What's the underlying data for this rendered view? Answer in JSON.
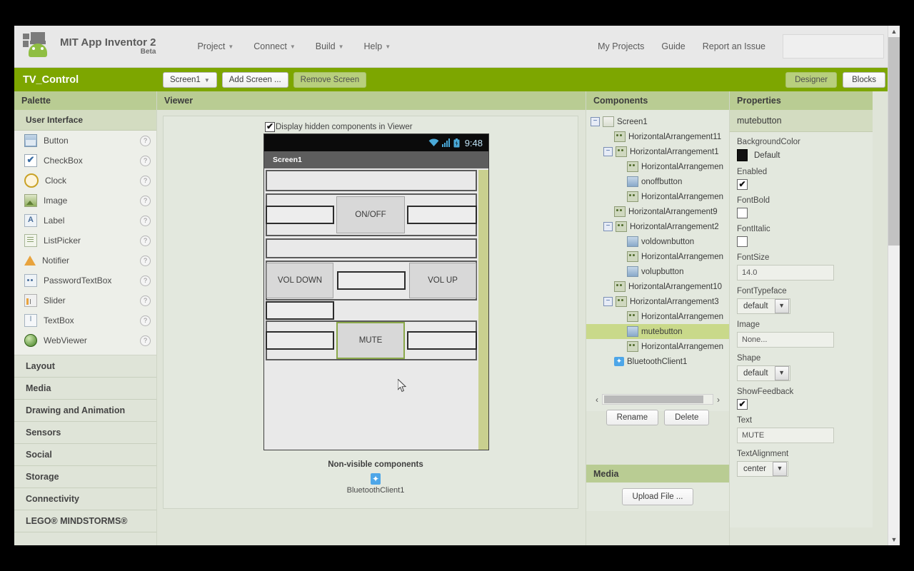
{
  "header": {
    "brand_name": "MIT App Inventor 2",
    "brand_sub": "Beta",
    "menus": [
      "Project",
      "Connect",
      "Build",
      "Help"
    ],
    "right_links": [
      "My Projects",
      "Guide",
      "Report an Issue"
    ],
    "search_value": ""
  },
  "project_bar": {
    "project_name": "TV_Control",
    "screen_select": "Screen1",
    "add_screen": "Add Screen ...",
    "remove_screen": "Remove Screen",
    "tabs": [
      "Designer",
      "Blocks"
    ],
    "active_tab": "Designer"
  },
  "palette": {
    "title": "Palette",
    "section": "User Interface",
    "items": [
      {
        "label": "Button",
        "icon": "button-icon"
      },
      {
        "label": "CheckBox",
        "icon": "checkbox-icon"
      },
      {
        "label": "Clock",
        "icon": "clock-icon"
      },
      {
        "label": "Image",
        "icon": "image-icon"
      },
      {
        "label": "Label",
        "icon": "label-icon"
      },
      {
        "label": "ListPicker",
        "icon": "listpicker-icon"
      },
      {
        "label": "Notifier",
        "icon": "notifier-icon"
      },
      {
        "label": "PasswordTextBox",
        "icon": "password-icon"
      },
      {
        "label": "Slider",
        "icon": "slider-icon"
      },
      {
        "label": "TextBox",
        "icon": "textbox-icon"
      },
      {
        "label": "WebViewer",
        "icon": "webviewer-icon"
      }
    ],
    "help_glyph": "?",
    "categories": [
      "Layout",
      "Media",
      "Drawing and Animation",
      "Sensors",
      "Social",
      "Storage",
      "Connectivity",
      "LEGO® MINDSTORMS®"
    ]
  },
  "viewer": {
    "title": "Viewer",
    "display_hidden_label": "Display hidden components in Viewer",
    "display_hidden_checked": true,
    "phone": {
      "status_time": "9:48",
      "screen_title": "Screen1",
      "buttons": {
        "onoff": "ON/OFF",
        "vol_down": "VOL DOWN",
        "vol_up": "VOL UP",
        "mute": "MUTE"
      },
      "selected_button": "MUTE"
    },
    "nonvisible_title": "Non-visible components",
    "nonvisible_items": [
      "BluetoothClient1"
    ]
  },
  "components": {
    "title": "Components",
    "tree": [
      {
        "label": "Screen1",
        "depth": 0,
        "icon": "screen-icon",
        "expander": "−",
        "selected": false
      },
      {
        "label": "HorizontalArrangement11",
        "depth": 1,
        "icon": "arrangement-icon",
        "expander": "",
        "selected": false
      },
      {
        "label": "HorizontalArrangement1",
        "depth": 1,
        "icon": "arrangement-icon",
        "expander": "−",
        "selected": false
      },
      {
        "label": "HorizontalArrangemen",
        "depth": 2,
        "icon": "arrangement-icon",
        "expander": "",
        "selected": false
      },
      {
        "label": "onoffbutton",
        "depth": 2,
        "icon": "button-icon",
        "expander": "",
        "selected": false
      },
      {
        "label": "HorizontalArrangemen",
        "depth": 2,
        "icon": "arrangement-icon",
        "expander": "",
        "selected": false
      },
      {
        "label": "HorizontalArrangement9",
        "depth": 1,
        "icon": "arrangement-icon",
        "expander": "",
        "selected": false
      },
      {
        "label": "HorizontalArrangement2",
        "depth": 1,
        "icon": "arrangement-icon",
        "expander": "−",
        "selected": false
      },
      {
        "label": "voldownbutton",
        "depth": 2,
        "icon": "button-icon",
        "expander": "",
        "selected": false
      },
      {
        "label": "HorizontalArrangemen",
        "depth": 2,
        "icon": "arrangement-icon",
        "expander": "",
        "selected": false
      },
      {
        "label": "volupbutton",
        "depth": 2,
        "icon": "button-icon",
        "expander": "",
        "selected": false
      },
      {
        "label": "HorizontalArrangement10",
        "depth": 1,
        "icon": "arrangement-icon",
        "expander": "",
        "selected": false
      },
      {
        "label": "HorizontalArrangement3",
        "depth": 1,
        "icon": "arrangement-icon",
        "expander": "−",
        "selected": false
      },
      {
        "label": "HorizontalArrangemen",
        "depth": 2,
        "icon": "arrangement-icon",
        "expander": "",
        "selected": false
      },
      {
        "label": "mutebutton",
        "depth": 2,
        "icon": "button-icon",
        "expander": "",
        "selected": true
      },
      {
        "label": "HorizontalArrangemen",
        "depth": 2,
        "icon": "arrangement-icon",
        "expander": "",
        "selected": false
      },
      {
        "label": "BluetoothClient1",
        "depth": 1,
        "icon": "bluetooth-icon",
        "expander": "",
        "selected": false
      }
    ],
    "rename_button": "Rename",
    "delete_button": "Delete",
    "scroll_left_glyph": "‹",
    "scroll_right_glyph": "›"
  },
  "media": {
    "title": "Media",
    "upload_button": "Upload File ..."
  },
  "properties": {
    "title": "Properties",
    "component_name": "mutebutton",
    "fields": [
      {
        "label": "BackgroundColor",
        "type": "color",
        "value": "Default",
        "swatch": "#111111"
      },
      {
        "label": "Enabled",
        "type": "checkbox",
        "checked": true
      },
      {
        "label": "FontBold",
        "type": "checkbox",
        "checked": false
      },
      {
        "label": "FontItalic",
        "type": "checkbox",
        "checked": false
      },
      {
        "label": "FontSize",
        "type": "text",
        "value": "14.0"
      },
      {
        "label": "FontTypeface",
        "type": "select",
        "value": "default"
      },
      {
        "label": "Image",
        "type": "text",
        "value": "None..."
      },
      {
        "label": "Shape",
        "type": "select",
        "value": "default"
      },
      {
        "label": "ShowFeedback",
        "type": "checkbox",
        "checked": true
      },
      {
        "label": "Text",
        "type": "text",
        "value": "MUTE"
      },
      {
        "label": "TextAlignment",
        "type": "select",
        "value": "center"
      }
    ]
  },
  "colors": {
    "accent_green": "#7da600",
    "panel_header": "#b9cc93",
    "panel_bg": "#dfe4d8",
    "selection": "#c9d98a"
  }
}
